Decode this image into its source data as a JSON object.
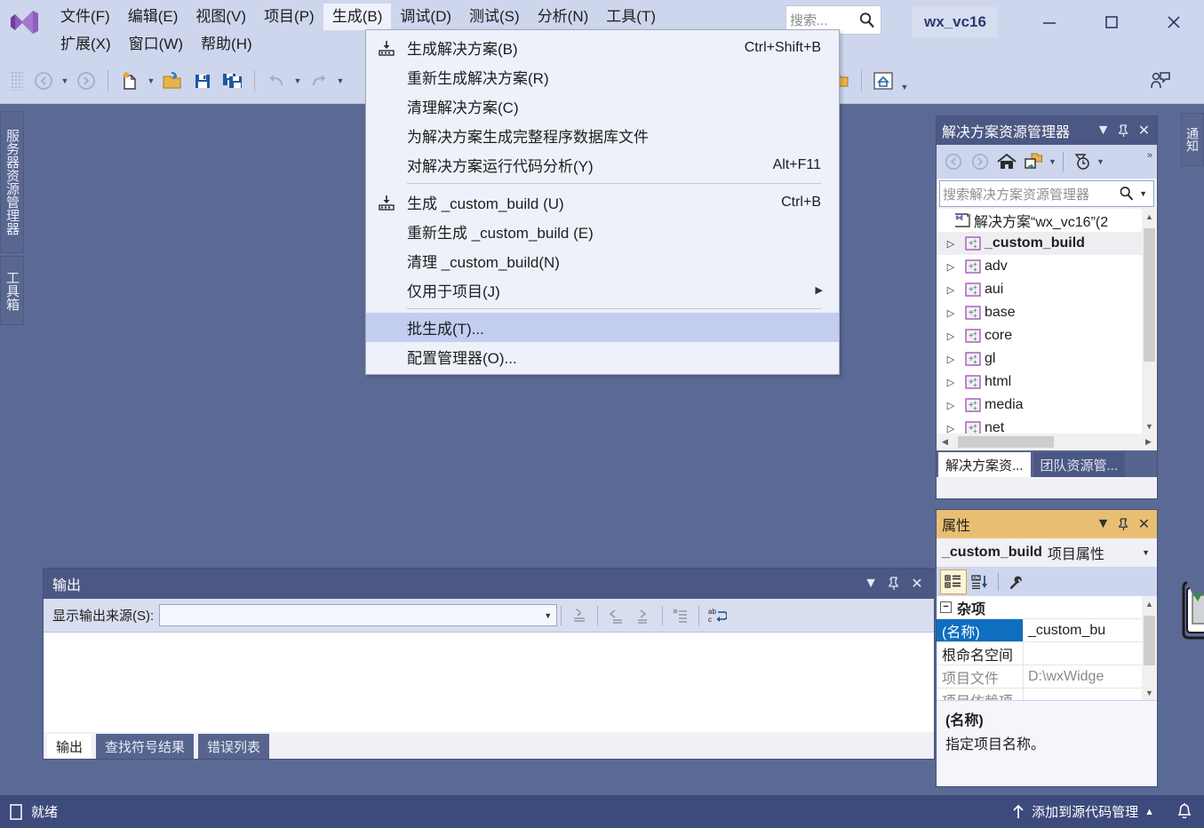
{
  "window": {
    "project_title": "wx_vc16",
    "minimize": "–",
    "maximize": "☐",
    "close": "✕"
  },
  "search": {
    "placeholder": "搜索..."
  },
  "menubar": {
    "row1": [
      {
        "label": "文件(F)",
        "name": "menu-file"
      },
      {
        "label": "编辑(E)",
        "name": "menu-edit"
      },
      {
        "label": "视图(V)",
        "name": "menu-view"
      },
      {
        "label": "项目(P)",
        "name": "menu-project"
      },
      {
        "label": "生成(B)",
        "name": "menu-build"
      },
      {
        "label": "调试(D)",
        "name": "menu-debug"
      },
      {
        "label": "测试(S)",
        "name": "menu-test"
      },
      {
        "label": "分析(N)",
        "name": "menu-analyze"
      },
      {
        "label": "工具(T)",
        "name": "menu-tools"
      }
    ],
    "row2": [
      {
        "label": "扩展(X)",
        "name": "menu-extensions"
      },
      {
        "label": "窗口(W)",
        "name": "menu-window"
      },
      {
        "label": "帮助(H)",
        "name": "menu-help"
      }
    ]
  },
  "build_menu": {
    "items": [
      {
        "label": "生成解决方案(B)",
        "shortcut": "Ctrl+Shift+B",
        "icon": "build-icon",
        "selected": false,
        "submenu": false
      },
      {
        "label": "重新生成解决方案(R)",
        "shortcut": "",
        "icon": "",
        "selected": false,
        "submenu": false
      },
      {
        "label": "清理解决方案(C)",
        "shortcut": "",
        "icon": "",
        "selected": false,
        "submenu": false
      },
      {
        "label": "为解决方案生成完整程序数据库文件",
        "shortcut": "",
        "icon": "",
        "selected": false,
        "submenu": false
      },
      {
        "label": "对解决方案运行代码分析(Y)",
        "shortcut": "Alt+F11",
        "icon": "",
        "selected": false,
        "submenu": false
      },
      {
        "separator": true
      },
      {
        "label": "生成 _custom_build (U)",
        "shortcut": "Ctrl+B",
        "icon": "build-icon",
        "selected": false,
        "submenu": false
      },
      {
        "label": "重新生成 _custom_build (E)",
        "shortcut": "",
        "icon": "",
        "selected": false,
        "submenu": false
      },
      {
        "label": "清理 _custom_build(N)",
        "shortcut": "",
        "icon": "",
        "selected": false,
        "submenu": false
      },
      {
        "label": "仅用于项目(J)",
        "shortcut": "",
        "icon": "",
        "selected": false,
        "submenu": true
      },
      {
        "separator": true
      },
      {
        "label": "批生成(T)...",
        "shortcut": "",
        "icon": "",
        "selected": true,
        "submenu": false
      },
      {
        "label": "配置管理器(O)...",
        "shortcut": "",
        "icon": "",
        "selected": false,
        "submenu": false
      }
    ]
  },
  "left_tabs": [
    {
      "label": "服务器资源管理器",
      "name": "left-tab-server-explorer"
    },
    {
      "label": "工具箱",
      "name": "left-tab-toolbox"
    }
  ],
  "right_tab": {
    "label": "通知"
  },
  "solution_explorer": {
    "title": "解决方案资源管理器",
    "search_placeholder": "搜索解决方案资源管理器",
    "root": "解决方案“wx_vc16”(2",
    "nodes": [
      {
        "label": "_custom_build",
        "selected": true
      },
      {
        "label": "adv",
        "selected": false
      },
      {
        "label": "aui",
        "selected": false
      },
      {
        "label": "base",
        "selected": false
      },
      {
        "label": "core",
        "selected": false
      },
      {
        "label": "gl",
        "selected": false
      },
      {
        "label": "html",
        "selected": false
      },
      {
        "label": "media",
        "selected": false
      },
      {
        "label": "net",
        "selected": false
      }
    ],
    "tabs": [
      {
        "label": "解决方案资...",
        "active": true
      },
      {
        "label": "团队资源管...",
        "active": false
      }
    ]
  },
  "properties": {
    "title": "属性",
    "object_name": "_custom_build",
    "object_kind": "项目属性",
    "category": "杂项",
    "rows": [
      {
        "key": "(名称)",
        "value": "_custom_bu",
        "selected": true,
        "dim": false
      },
      {
        "key": "根命名空间",
        "value": "",
        "selected": false,
        "dim": false
      },
      {
        "key": "项目文件",
        "value": "D:\\wxWidge",
        "selected": false,
        "dim": true
      },
      {
        "key": "项目依赖项",
        "value": "",
        "selected": false,
        "dim": true
      }
    ],
    "desc_title": "(名称)",
    "desc_body": "指定项目名称。"
  },
  "output": {
    "title": "输出",
    "source_label": "显示输出来源(S):",
    "source_value": "",
    "tabs": [
      {
        "label": "输出",
        "active": true
      },
      {
        "label": "查找符号结果",
        "active": false
      },
      {
        "label": "错误列表",
        "active": false
      }
    ]
  },
  "status_bar": {
    "ready": "就绪",
    "source_control": "添加到源代码管理",
    "source_control_caret": "▲"
  },
  "colors": {
    "workspace_bg": "#5b6995",
    "chrome_bg": "#cdd6ed",
    "pane_header": "#4b5884",
    "properties_header": "#e8bf72",
    "menu_bg": "#eef1fa",
    "menu_selected": "#c2cdf0",
    "status_bar": "#3d4a7c",
    "accent_purple": "#8f5fbf"
  }
}
